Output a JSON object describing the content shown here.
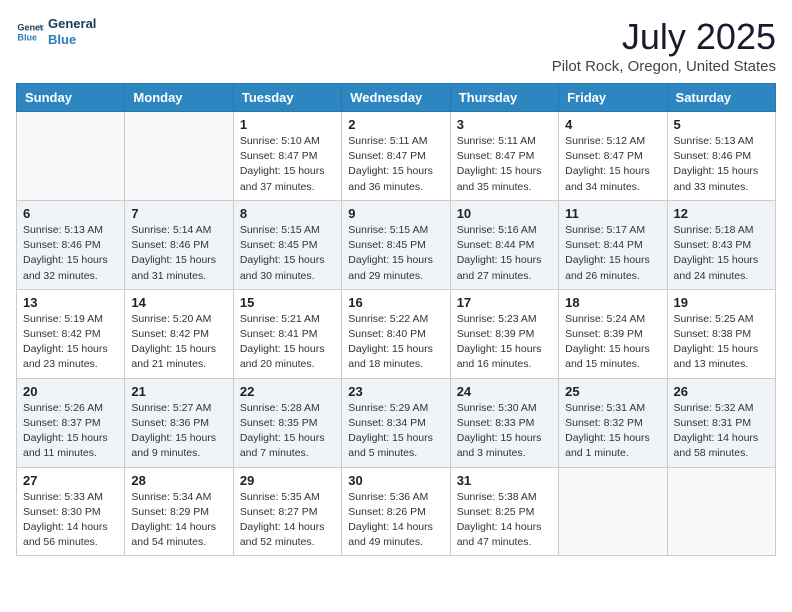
{
  "header": {
    "logo_line1": "General",
    "logo_line2": "Blue",
    "title": "July 2025",
    "subtitle": "Pilot Rock, Oregon, United States"
  },
  "weekdays": [
    "Sunday",
    "Monday",
    "Tuesday",
    "Wednesday",
    "Thursday",
    "Friday",
    "Saturday"
  ],
  "weeks": [
    [
      {
        "day": "",
        "sunrise": "",
        "sunset": "",
        "daylight": ""
      },
      {
        "day": "",
        "sunrise": "",
        "sunset": "",
        "daylight": ""
      },
      {
        "day": "1",
        "sunrise": "Sunrise: 5:10 AM",
        "sunset": "Sunset: 8:47 PM",
        "daylight": "Daylight: 15 hours and 37 minutes."
      },
      {
        "day": "2",
        "sunrise": "Sunrise: 5:11 AM",
        "sunset": "Sunset: 8:47 PM",
        "daylight": "Daylight: 15 hours and 36 minutes."
      },
      {
        "day": "3",
        "sunrise": "Sunrise: 5:11 AM",
        "sunset": "Sunset: 8:47 PM",
        "daylight": "Daylight: 15 hours and 35 minutes."
      },
      {
        "day": "4",
        "sunrise": "Sunrise: 5:12 AM",
        "sunset": "Sunset: 8:47 PM",
        "daylight": "Daylight: 15 hours and 34 minutes."
      },
      {
        "day": "5",
        "sunrise": "Sunrise: 5:13 AM",
        "sunset": "Sunset: 8:46 PM",
        "daylight": "Daylight: 15 hours and 33 minutes."
      }
    ],
    [
      {
        "day": "6",
        "sunrise": "Sunrise: 5:13 AM",
        "sunset": "Sunset: 8:46 PM",
        "daylight": "Daylight: 15 hours and 32 minutes."
      },
      {
        "day": "7",
        "sunrise": "Sunrise: 5:14 AM",
        "sunset": "Sunset: 8:46 PM",
        "daylight": "Daylight: 15 hours and 31 minutes."
      },
      {
        "day": "8",
        "sunrise": "Sunrise: 5:15 AM",
        "sunset": "Sunset: 8:45 PM",
        "daylight": "Daylight: 15 hours and 30 minutes."
      },
      {
        "day": "9",
        "sunrise": "Sunrise: 5:15 AM",
        "sunset": "Sunset: 8:45 PM",
        "daylight": "Daylight: 15 hours and 29 minutes."
      },
      {
        "day": "10",
        "sunrise": "Sunrise: 5:16 AM",
        "sunset": "Sunset: 8:44 PM",
        "daylight": "Daylight: 15 hours and 27 minutes."
      },
      {
        "day": "11",
        "sunrise": "Sunrise: 5:17 AM",
        "sunset": "Sunset: 8:44 PM",
        "daylight": "Daylight: 15 hours and 26 minutes."
      },
      {
        "day": "12",
        "sunrise": "Sunrise: 5:18 AM",
        "sunset": "Sunset: 8:43 PM",
        "daylight": "Daylight: 15 hours and 24 minutes."
      }
    ],
    [
      {
        "day": "13",
        "sunrise": "Sunrise: 5:19 AM",
        "sunset": "Sunset: 8:42 PM",
        "daylight": "Daylight: 15 hours and 23 minutes."
      },
      {
        "day": "14",
        "sunrise": "Sunrise: 5:20 AM",
        "sunset": "Sunset: 8:42 PM",
        "daylight": "Daylight: 15 hours and 21 minutes."
      },
      {
        "day": "15",
        "sunrise": "Sunrise: 5:21 AM",
        "sunset": "Sunset: 8:41 PM",
        "daylight": "Daylight: 15 hours and 20 minutes."
      },
      {
        "day": "16",
        "sunrise": "Sunrise: 5:22 AM",
        "sunset": "Sunset: 8:40 PM",
        "daylight": "Daylight: 15 hours and 18 minutes."
      },
      {
        "day": "17",
        "sunrise": "Sunrise: 5:23 AM",
        "sunset": "Sunset: 8:39 PM",
        "daylight": "Daylight: 15 hours and 16 minutes."
      },
      {
        "day": "18",
        "sunrise": "Sunrise: 5:24 AM",
        "sunset": "Sunset: 8:39 PM",
        "daylight": "Daylight: 15 hours and 15 minutes."
      },
      {
        "day": "19",
        "sunrise": "Sunrise: 5:25 AM",
        "sunset": "Sunset: 8:38 PM",
        "daylight": "Daylight: 15 hours and 13 minutes."
      }
    ],
    [
      {
        "day": "20",
        "sunrise": "Sunrise: 5:26 AM",
        "sunset": "Sunset: 8:37 PM",
        "daylight": "Daylight: 15 hours and 11 minutes."
      },
      {
        "day": "21",
        "sunrise": "Sunrise: 5:27 AM",
        "sunset": "Sunset: 8:36 PM",
        "daylight": "Daylight: 15 hours and 9 minutes."
      },
      {
        "day": "22",
        "sunrise": "Sunrise: 5:28 AM",
        "sunset": "Sunset: 8:35 PM",
        "daylight": "Daylight: 15 hours and 7 minutes."
      },
      {
        "day": "23",
        "sunrise": "Sunrise: 5:29 AM",
        "sunset": "Sunset: 8:34 PM",
        "daylight": "Daylight: 15 hours and 5 minutes."
      },
      {
        "day": "24",
        "sunrise": "Sunrise: 5:30 AM",
        "sunset": "Sunset: 8:33 PM",
        "daylight": "Daylight: 15 hours and 3 minutes."
      },
      {
        "day": "25",
        "sunrise": "Sunrise: 5:31 AM",
        "sunset": "Sunset: 8:32 PM",
        "daylight": "Daylight: 15 hours and 1 minute."
      },
      {
        "day": "26",
        "sunrise": "Sunrise: 5:32 AM",
        "sunset": "Sunset: 8:31 PM",
        "daylight": "Daylight: 14 hours and 58 minutes."
      }
    ],
    [
      {
        "day": "27",
        "sunrise": "Sunrise: 5:33 AM",
        "sunset": "Sunset: 8:30 PM",
        "daylight": "Daylight: 14 hours and 56 minutes."
      },
      {
        "day": "28",
        "sunrise": "Sunrise: 5:34 AM",
        "sunset": "Sunset: 8:29 PM",
        "daylight": "Daylight: 14 hours and 54 minutes."
      },
      {
        "day": "29",
        "sunrise": "Sunrise: 5:35 AM",
        "sunset": "Sunset: 8:27 PM",
        "daylight": "Daylight: 14 hours and 52 minutes."
      },
      {
        "day": "30",
        "sunrise": "Sunrise: 5:36 AM",
        "sunset": "Sunset: 8:26 PM",
        "daylight": "Daylight: 14 hours and 49 minutes."
      },
      {
        "day": "31",
        "sunrise": "Sunrise: 5:38 AM",
        "sunset": "Sunset: 8:25 PM",
        "daylight": "Daylight: 14 hours and 47 minutes."
      },
      {
        "day": "",
        "sunrise": "",
        "sunset": "",
        "daylight": ""
      },
      {
        "day": "",
        "sunrise": "",
        "sunset": "",
        "daylight": ""
      }
    ]
  ]
}
